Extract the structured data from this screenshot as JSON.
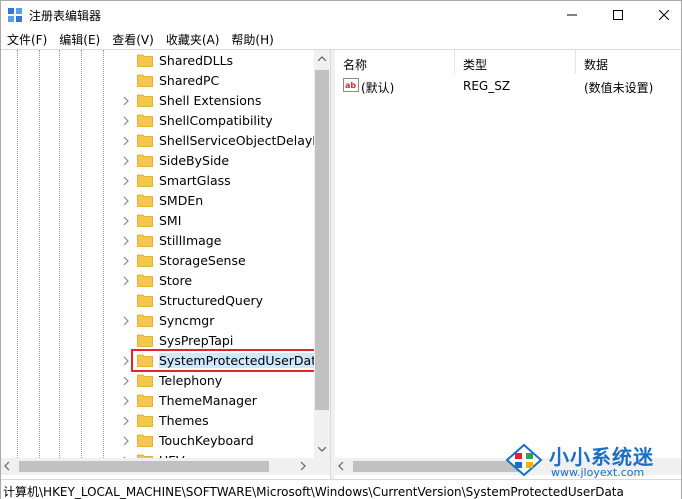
{
  "window": {
    "title": "注册表编辑器",
    "icon": "regedit-icon"
  },
  "menu": {
    "items": [
      {
        "label": "文件(F)"
      },
      {
        "label": "编辑(E)"
      },
      {
        "label": "查看(V)"
      },
      {
        "label": "收藏夹(A)"
      },
      {
        "label": "帮助(H)"
      }
    ]
  },
  "tree": {
    "items": [
      {
        "label": "SharedDLLs",
        "expandable": false
      },
      {
        "label": "SharedPC",
        "expandable": false
      },
      {
        "label": "Shell Extensions",
        "expandable": true
      },
      {
        "label": "ShellCompatibility",
        "expandable": true
      },
      {
        "label": "ShellServiceObjectDelayLoa",
        "expandable": true
      },
      {
        "label": "SideBySide",
        "expandable": true
      },
      {
        "label": "SmartGlass",
        "expandable": true
      },
      {
        "label": "SMDEn",
        "expandable": true
      },
      {
        "label": "SMI",
        "expandable": true
      },
      {
        "label": "StillImage",
        "expandable": true
      },
      {
        "label": "StorageSense",
        "expandable": true
      },
      {
        "label": "Store",
        "expandable": true
      },
      {
        "label": "StructuredQuery",
        "expandable": false
      },
      {
        "label": "Syncmgr",
        "expandable": true
      },
      {
        "label": "SysPrepTapi",
        "expandable": false
      },
      {
        "label": "SystemProtectedUserData",
        "expandable": true,
        "selected": true
      },
      {
        "label": "Telephony",
        "expandable": true
      },
      {
        "label": "ThemeManager",
        "expandable": true
      },
      {
        "label": "Themes",
        "expandable": true
      },
      {
        "label": "TouchKeyboard",
        "expandable": true
      },
      {
        "label": "UEV",
        "expandable": true
      }
    ]
  },
  "list": {
    "headers": {
      "name": "名称",
      "type": "类型",
      "data": "数据"
    },
    "rows": [
      {
        "name": "(默认)",
        "type": "REG_SZ",
        "data": "(数值未设置)",
        "icon": "string-value-icon"
      }
    ]
  },
  "status": {
    "path": "计算机\\HKEY_LOCAL_MACHINE\\SOFTWARE\\Microsoft\\Windows\\CurrentVersion\\SystemProtectedUserData"
  },
  "watermark": {
    "title": "小小系统迷",
    "url": "www.jloyext.com"
  },
  "colors": {
    "highlight_box": "#e8202a",
    "folder": "#f4c64a",
    "watermark_blue": "#1a6fc4"
  }
}
